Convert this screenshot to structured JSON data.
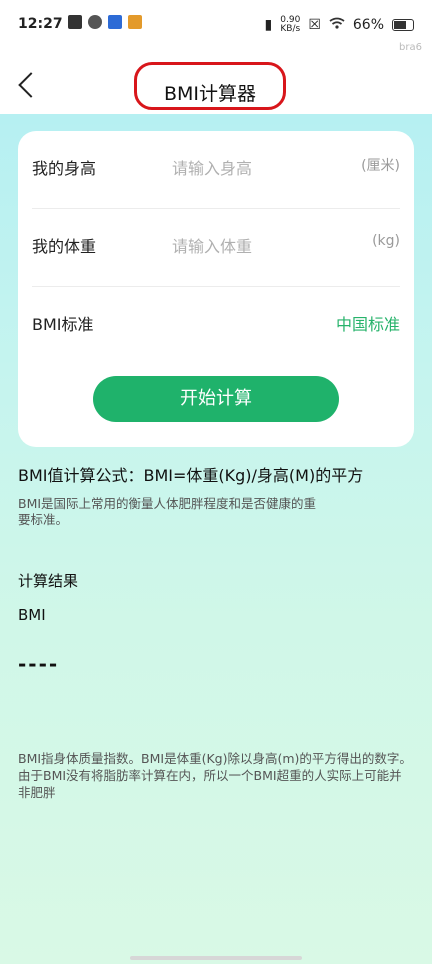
{
  "status": {
    "time": "12:27",
    "speed_value": "0.90",
    "speed_unit": "KB/s",
    "battery": "66%",
    "badge": "bra6"
  },
  "header": {
    "title": "BMI计算器"
  },
  "form": {
    "height_label": "我的身高",
    "height_placeholder": "请输入身高",
    "height_unit": "(厘米)",
    "weight_label": "我的体重",
    "weight_placeholder": "请输入体重",
    "weight_unit": "(kg)",
    "standard_label": "BMI标准",
    "standard_value": "中国标准",
    "start_button": "开始计算"
  },
  "info": {
    "formula": "BMI值计算公式：BMI=体重(Kg)/身高(M)的平方",
    "description": "BMI是国际上常用的衡量人体肥胖程度和是否健康的重要标准。"
  },
  "result": {
    "title": "计算结果",
    "bmi_label": "BMI",
    "bmi_value": "----"
  },
  "note": "BMI指身体质量指数。BMI是体重(Kg)除以身高(m)的平方得出的数字。由于BMI没有将脂肪率计算在内，所以一个BMI超重的人实际上可能并非肥胖",
  "colors": {
    "accent": "#1fb26b",
    "highlight": "#d8161b",
    "bg_top": "#b6f0f2",
    "bg_bottom": "#d9f9e6"
  }
}
